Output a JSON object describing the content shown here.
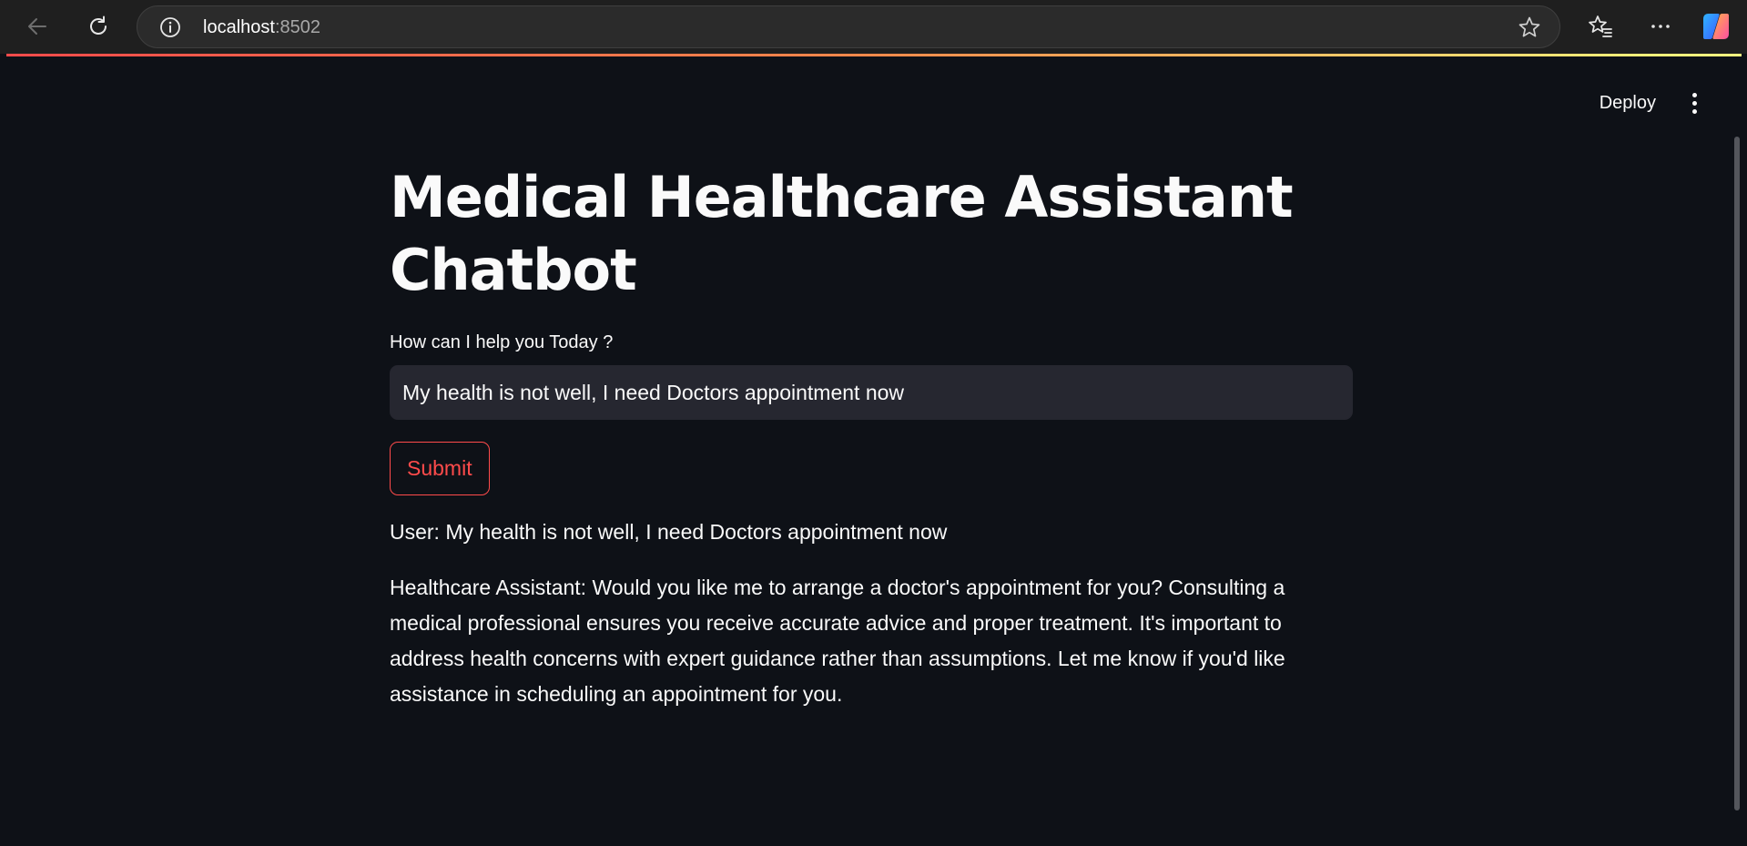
{
  "browser": {
    "url_host": "localhost",
    "url_port": ":8502",
    "icons": [
      "back-arrow-icon",
      "reload-icon",
      "info-icon",
      "star-icon",
      "favorites-icon",
      "more-icon",
      "copilot-icon"
    ]
  },
  "header": {
    "deploy_label": "Deploy"
  },
  "main": {
    "title": "Medical Healthcare Assistant Chatbot",
    "input_label": "How can I help you Today ?",
    "input_value": "My health is not well, I need Doctors appointment now",
    "submit_label": "Submit",
    "messages": [
      {
        "text": "User: My health is not well, I need Doctors appointment now"
      },
      {
        "text": "Healthcare Assistant: Would you like me to arrange a doctor's appointment for you? Consulting a medical professional ensures you receive accurate advice and proper treatment. It's important to address health concerns with expert guidance rather than assumptions. Let me know if you'd like assistance in scheduling an appointment for you."
      }
    ]
  },
  "colors": {
    "background": "#0e1117",
    "accent": "#ff4b4b",
    "input_bg": "#262730",
    "text": "#fafafa"
  }
}
